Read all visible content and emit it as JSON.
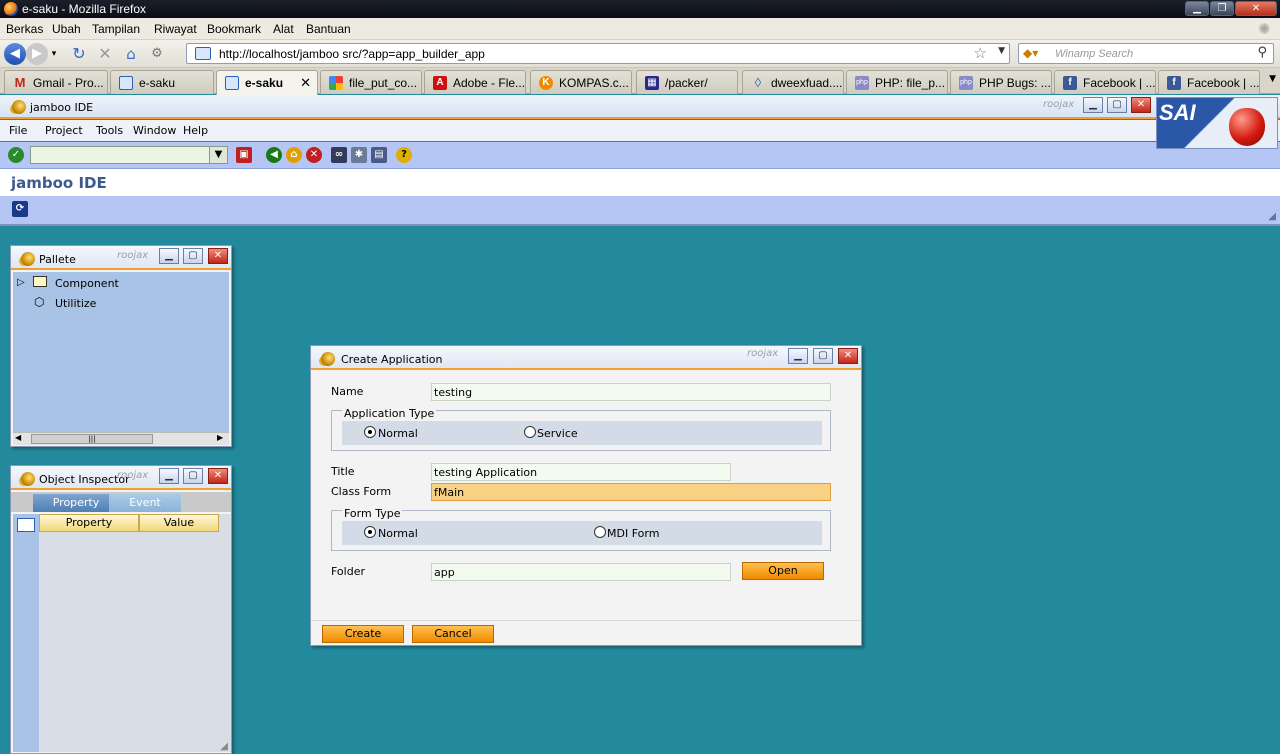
{
  "browser": {
    "window_title": "e-saku - Mozilla Firefox",
    "menu": [
      "Berkas",
      "Ubah",
      "Tampilan",
      "Riwayat",
      "Bookmark",
      "Alat",
      "Bantuan"
    ],
    "url": "http://localhost/jamboo src/?app=app_builder_app",
    "search_placeholder": "Winamp Search",
    "tabs": [
      {
        "label": "Gmail - Pro...",
        "icon": "gmail-icon",
        "color": "#c0281c"
      },
      {
        "label": "e-saku",
        "icon": "page-icon",
        "color": "#2b62b8"
      },
      {
        "label": "e-saku",
        "icon": "page-icon",
        "color": "#2b62b8"
      },
      {
        "label": "file_put_co...",
        "icon": "google-icon",
        "color": "#3a7be0"
      },
      {
        "label": "Adobe - Fle...",
        "icon": "adobe-icon",
        "color": "#d01010"
      },
      {
        "label": "KOMPAS.c...",
        "icon": "kompas-icon",
        "color": "#f08a00"
      },
      {
        "label": "/packer/",
        "icon": "packer-icon",
        "color": "#2a2a8a"
      },
      {
        "label": "dweexfuad....",
        "icon": "diamond-icon",
        "color": "#3a6ab8"
      },
      {
        "label": "PHP: file_p...",
        "icon": "php-icon",
        "color": "#6a6aa8"
      },
      {
        "label": "PHP Bugs: ...",
        "icon": "php-icon",
        "color": "#6a6aa8"
      },
      {
        "label": "Facebook | ...",
        "icon": "facebook-icon",
        "color": "#3b5998"
      },
      {
        "label": "Facebook | ...",
        "icon": "facebook-icon",
        "color": "#3b5998"
      }
    ]
  },
  "ide": {
    "window_title": "jamboo IDE",
    "brand_small": "roojax",
    "menu": [
      "File",
      "Project",
      "Tools",
      "Window",
      "Help"
    ],
    "app_name": "jamboo IDE",
    "logo_text": "SAI"
  },
  "pallete": {
    "title": "Pallete",
    "brand": "roojax",
    "items": [
      {
        "label": "Component",
        "icon": "folder-icon"
      },
      {
        "label": "Utilitize",
        "icon": "box-icon"
      }
    ]
  },
  "inspector": {
    "title": "Object Inspector",
    "brand": "roojax",
    "tabs": [
      "Property",
      "Event"
    ],
    "columns": [
      "Property",
      "Value"
    ]
  },
  "dialog": {
    "title": "Create Application",
    "brand": "roojax",
    "name_label": "Name",
    "name_value": "testing",
    "app_type_label": "Application Type",
    "app_type_options": [
      "Normal",
      "Service"
    ],
    "title_label": "Title",
    "title_value": "testing Application",
    "class_form_label": "Class Form",
    "class_form_value": "fMain",
    "form_type_label": "Form Type",
    "form_type_options": [
      "Normal",
      "MDI Form"
    ],
    "folder_label": "Folder",
    "folder_value": "app",
    "open_label": "Open",
    "create_label": "Create",
    "cancel_label": "Cancel"
  }
}
